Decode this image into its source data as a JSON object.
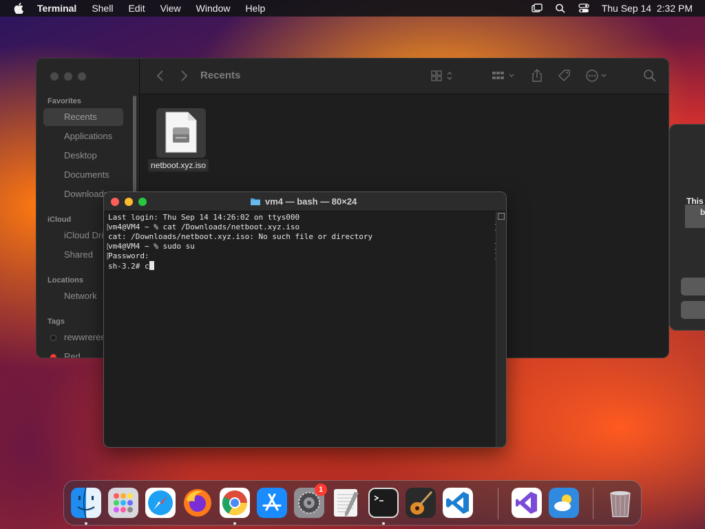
{
  "menubar": {
    "app_name": "Terminal",
    "menus": [
      "Shell",
      "Edit",
      "View",
      "Window",
      "Help"
    ],
    "clock": "Thu Sep 14  2:32 PM"
  },
  "finder": {
    "title": "Recents",
    "sidebar": {
      "favorites_header": "Favorites",
      "favorites": [
        "Recents",
        "Applications",
        "Desktop",
        "Documents",
        "Downloads"
      ],
      "icloud_header": "iCloud",
      "icloud": [
        "iCloud Drive",
        "Shared"
      ],
      "locations_header": "Locations",
      "locations": [
        "Network"
      ],
      "tags_header": "Tags",
      "tags": [
        {
          "label": "rewwrerere",
          "color": "#1a1a1a"
        },
        {
          "label": "Red",
          "color": "#ff3b30"
        }
      ]
    },
    "files": [
      {
        "name": "netboot.xyz.iso",
        "icon": "disk-image-icon"
      }
    ]
  },
  "dialog": {
    "text_line1": "This",
    "text_line2": "b"
  },
  "terminal": {
    "title": "vm4 — bash — 80×24",
    "lines": [
      "Last login: Thu Sep 14 14:26:02 on ttys000",
      "vm4@VM4 ~ % cat /Downloads/netboot.xyz.iso",
      "cat: /Downloads/netboot.xyz.iso: No such file or directory",
      "vm4@VM4 ~ % sudo su",
      "Password:",
      "sh-3.2# c"
    ]
  },
  "dock": {
    "apps": [
      {
        "name": "finder-icon",
        "running": true,
        "badge": ""
      },
      {
        "name": "launchpad-icon",
        "running": false,
        "badge": ""
      },
      {
        "name": "safari-icon",
        "running": false,
        "badge": ""
      },
      {
        "name": "firefox-icon",
        "running": false,
        "badge": ""
      },
      {
        "name": "chrome-icon",
        "running": true,
        "badge": ""
      },
      {
        "name": "app-store-icon",
        "running": false,
        "badge": ""
      },
      {
        "name": "system-settings-icon",
        "running": false,
        "badge": "1"
      },
      {
        "name": "textedit-icon",
        "running": false,
        "badge": ""
      },
      {
        "name": "terminal-icon",
        "running": true,
        "badge": ""
      },
      {
        "name": "garageband-icon",
        "running": false,
        "badge": ""
      },
      {
        "name": "vscode-icon",
        "running": false,
        "badge": ""
      },
      {
        "name": "visual-studio-icon",
        "running": false,
        "badge": ""
      },
      {
        "name": "weather-icon",
        "running": false,
        "badge": ""
      },
      {
        "name": "trash-icon",
        "running": false,
        "badge": ""
      }
    ]
  },
  "colors": {
    "terminal_bg": "#1e1e1e",
    "traffic_red": "#ff5f57",
    "traffic_yellow": "#febc2e",
    "traffic_green": "#28c840",
    "badge_red": "#ff3b30"
  }
}
